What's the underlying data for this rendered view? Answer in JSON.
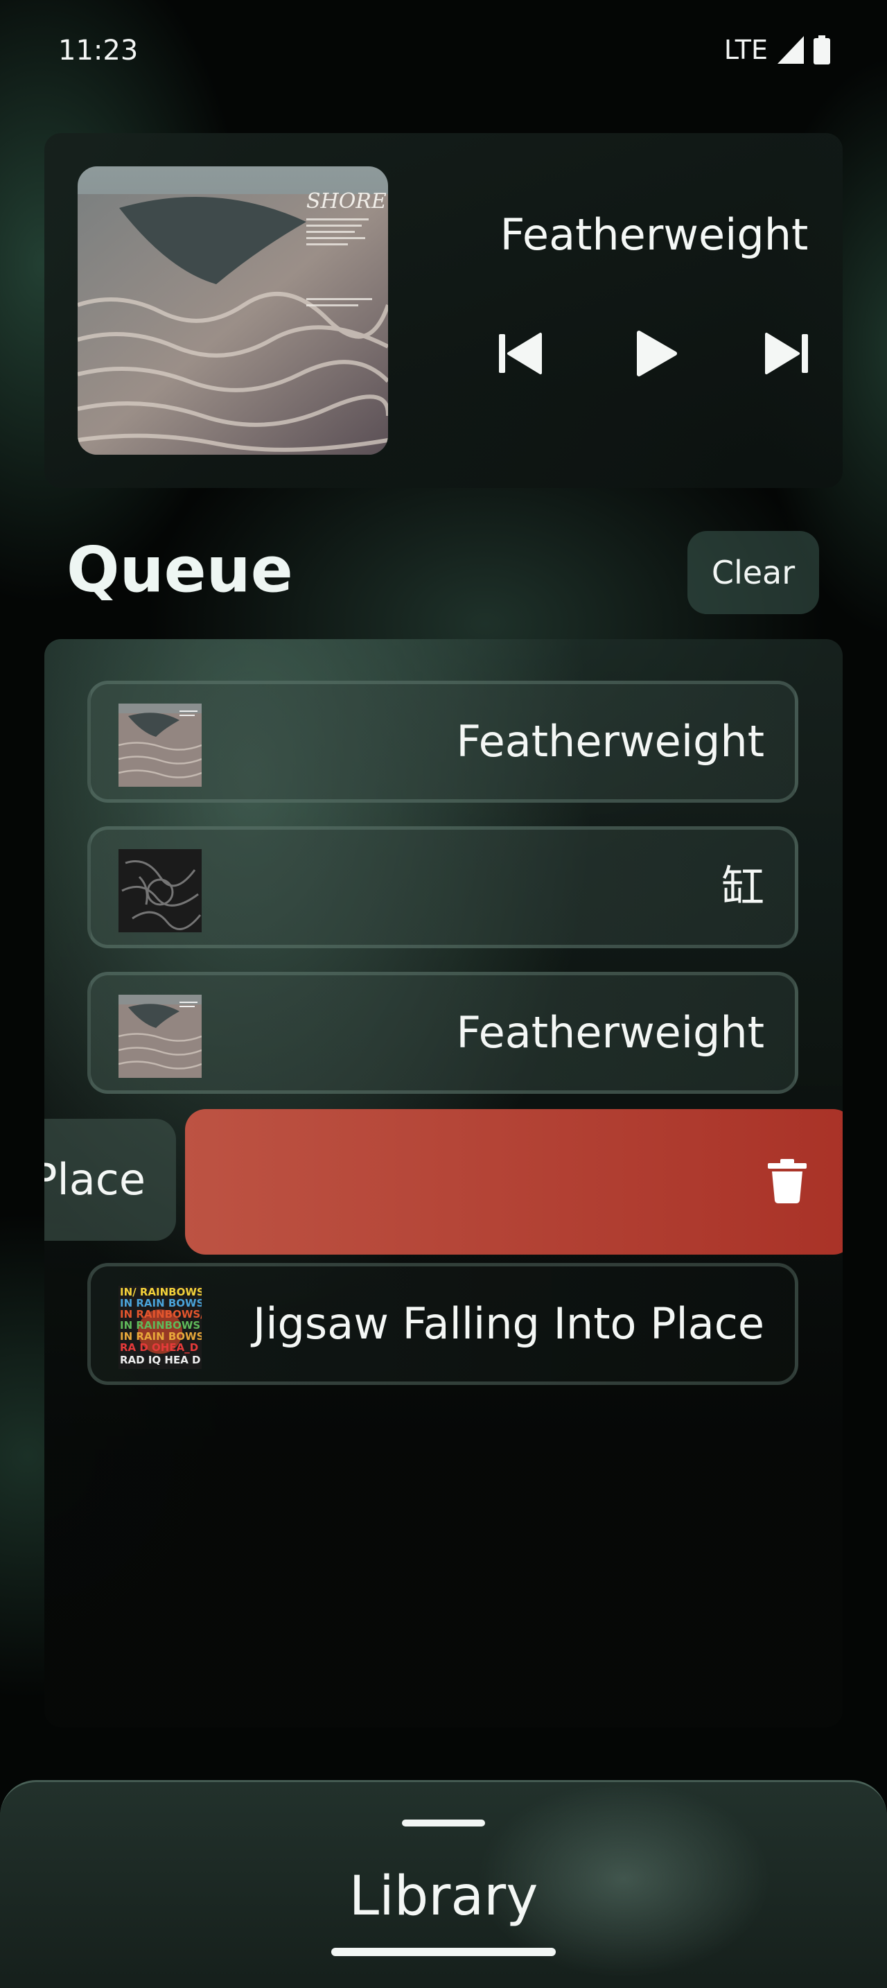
{
  "status_bar": {
    "time": "11:23",
    "network": "LTE",
    "signal_icon": "signal-icon",
    "battery_icon": "battery-icon"
  },
  "now_playing": {
    "title": "Featherweight",
    "album_art_text": "SHORE",
    "controls": {
      "previous_icon": "skip-previous-icon",
      "play_icon": "play-icon",
      "next_icon": "skip-next-icon"
    }
  },
  "queue": {
    "title": "Queue",
    "clear_label": "Clear",
    "items": [
      {
        "title": "Featherweight",
        "art": "shore-album-art"
      },
      {
        "title": "缸",
        "art": "dark-album-art"
      },
      {
        "title": "Featherweight",
        "art": "shore-album-art"
      },
      {
        "title": "Jigsaw Falling Into Place",
        "art": "in-rainbows-album-art"
      }
    ],
    "swiped_item": {
      "visible_text": "Place",
      "delete_icon": "trash-icon",
      "delete_color": "#b8483a"
    },
    "in_rainbows_art_lines": [
      "IN/ RAINBOWS",
      "IN RAIN BOWS",
      "IN RAINBOWS/",
      "IN RAINBOWS",
      "IN RAIN BOWS",
      "RA D OHEA_D",
      "RAD IQ HEA D"
    ]
  },
  "library_sheet": {
    "label": "Library"
  },
  "colors": {
    "accent_green": "#4f6f62",
    "delete_red": "#b8483a",
    "text": "#f4f7f5"
  }
}
